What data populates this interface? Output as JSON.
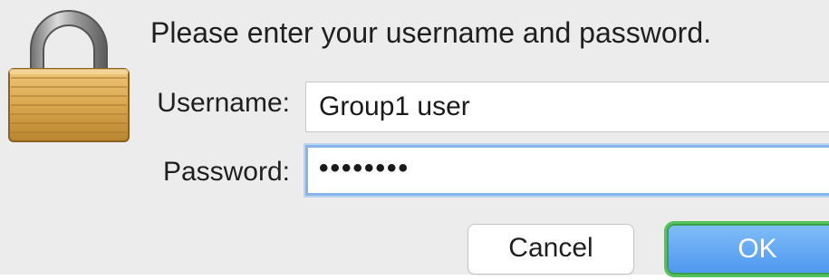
{
  "dialog": {
    "prompt": "Please enter your username and password.",
    "username_label": "Username:",
    "username_value": "Group1 user",
    "password_label": "Password:",
    "password_masked": "••••••••",
    "cancel_label": "Cancel",
    "ok_label": "OK",
    "icon": "padlock-icon"
  },
  "colors": {
    "dialog_background": "#ececec",
    "focus_ring": "#89b4e8",
    "default_button": "#4f98f0",
    "default_button_outline": "#56c25c"
  }
}
